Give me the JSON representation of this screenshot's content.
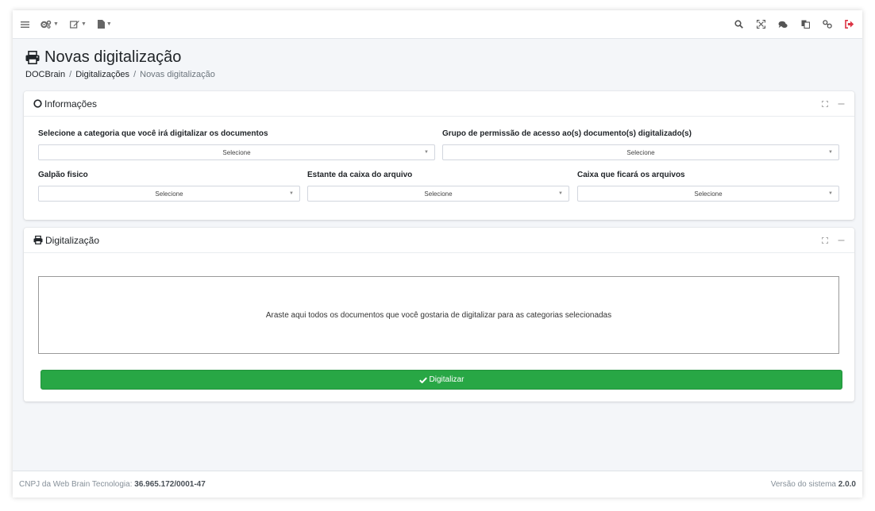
{
  "topbar": {
    "left": [
      {
        "icon": "menu-icon"
      },
      {
        "icon": "gears-icon"
      },
      {
        "icon": "edit-icon"
      },
      {
        "icon": "file-icon"
      }
    ],
    "right": [
      {
        "icon": "search-icon"
      },
      {
        "icon": "fullscreen-icon"
      },
      {
        "icon": "comments-icon"
      },
      {
        "icon": "copy-icon"
      },
      {
        "icon": "link-icon"
      },
      {
        "icon": "logout-icon",
        "color": "#dc3545"
      }
    ]
  },
  "page": {
    "title": "Novas digitalização",
    "breadcrumb": [
      "DOCBrain",
      "Digitalizações",
      "Novas digitalização"
    ]
  },
  "informacoes": {
    "title": "Informações",
    "fields": {
      "categoria": {
        "label": "Selecione a categoria que você irá digitalizar os documentos",
        "value": "Selecione"
      },
      "grupo": {
        "label": "Grupo de permissão de acesso ao(s) documento(s) digitalizado(s)",
        "value": "Selecione"
      },
      "galpao": {
        "label": "Galpão fisico",
        "value": "Selecione"
      },
      "estante": {
        "label": "Estante da caixa do arquivo",
        "value": "Selecione"
      },
      "caixa": {
        "label": "Caixa que ficará os arquivos",
        "value": "Selecione"
      }
    }
  },
  "digitalizacao": {
    "title": "Digitalização",
    "dropzone": "Araste aqui todos os documentos que você gostaria de digitalizar para as categorias selecionadas",
    "button": "Digitalizar"
  },
  "footer": {
    "cnpj_prefix": "CNPJ da Web Brain Tecnologia:",
    "cnpj": "36.965.172/0001-47",
    "version_prefix": "Versão do sistema",
    "version": "2.0.0"
  },
  "colors": {
    "success": "#28a745",
    "danger": "#dc3545",
    "background": "#f4f6f9"
  }
}
